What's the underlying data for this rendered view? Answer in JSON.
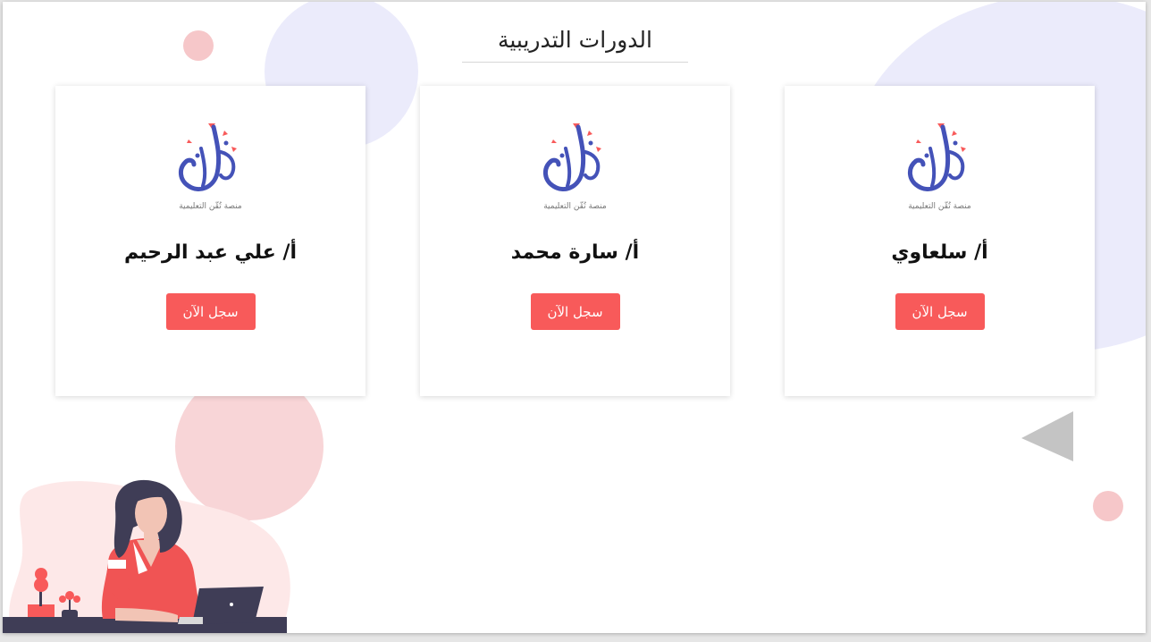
{
  "section": {
    "title": "الدورات التدريبية"
  },
  "logo": {
    "caption": "منصة تُقّن التعليمية"
  },
  "cards": [
    {
      "instructor": "أ/ علي عبد الرحيم",
      "button_label": "سجل الآن"
    },
    {
      "instructor": "أ/ سارة محمد",
      "button_label": "سجل الآن"
    },
    {
      "instructor": "أ/ سلعاوي",
      "button_label": "سجل الآن"
    }
  ],
  "colors": {
    "accent": "#f85a5a",
    "logo_blue": "#4452b8",
    "deco_lavender": "#ebebfb",
    "deco_pink": "#f6c7c9",
    "deco_gray": "#c4c4c4"
  }
}
